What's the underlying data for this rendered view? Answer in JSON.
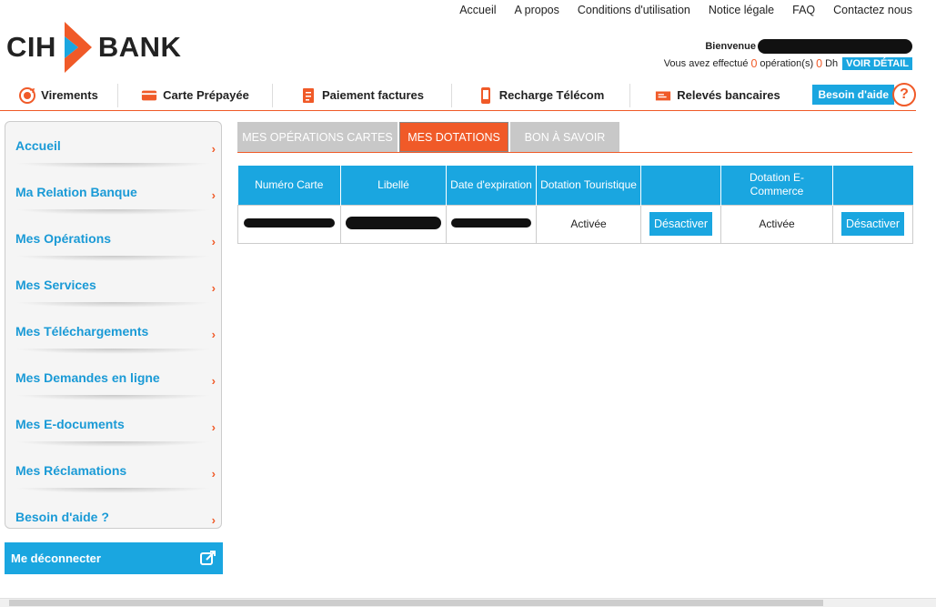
{
  "toplinks": [
    "Accueil",
    "A propos",
    "Conditions d'utilisation",
    "Notice légale",
    "FAQ",
    "Contactez nous"
  ],
  "logo": {
    "left": "CIH",
    "right": "BANK"
  },
  "welcome": {
    "hello": "Bienvenue",
    "ops_prefix": "Vous avez effectué",
    "ops_count": "0",
    "ops_mid": "opération(s)",
    "ops_amount": "0",
    "ops_unit": "Dh",
    "voir_detail": "VOIR DÉTAIL"
  },
  "mainnav": [
    {
      "label": "Virements",
      "icon": "globe-icon"
    },
    {
      "label": "Carte Prépayée",
      "icon": "card-icon"
    },
    {
      "label": "Paiement factures",
      "icon": "bill-icon"
    },
    {
      "label": "Recharge Télécom",
      "icon": "phone-icon"
    },
    {
      "label": "Relevés bancaires",
      "icon": "statement-icon"
    }
  ],
  "help": {
    "label": "Besoin d'aide",
    "symbol": "?"
  },
  "sidebar": [
    "Accueil",
    "Ma Relation Banque",
    "Mes Opérations",
    "Mes Services",
    "Mes Téléchargements",
    "Mes Demandes en ligne",
    "Mes E-documents",
    "Mes Réclamations",
    "Besoin d'aide ?"
  ],
  "logout": "Me déconnecter",
  "tabs": [
    {
      "label": "MES OPÉRATIONS CARTES",
      "active": false
    },
    {
      "label": "MES DOTATIONS",
      "active": true
    },
    {
      "label": "BON À SAVOIR",
      "active": false
    }
  ],
  "table": {
    "headers": [
      "Numéro Carte",
      "Libellé",
      "Date d'expiration",
      "Dotation Touristique",
      "",
      "Dotation E-Commerce",
      ""
    ],
    "row": {
      "dotation_touristique": "Activée",
      "btn1": "Désactiver",
      "dotation_ecommerce": "Activée",
      "btn2": "Désactiver"
    }
  },
  "colors": {
    "accent": "#f05a28",
    "blue": "#1aa6e0"
  }
}
